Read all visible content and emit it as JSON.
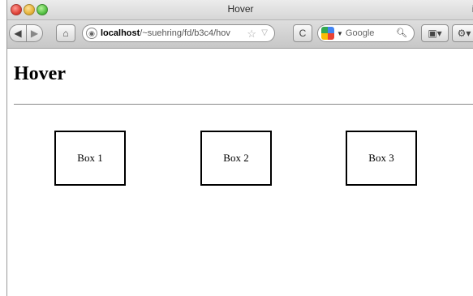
{
  "window": {
    "title": "Hover",
    "title_suffix": "i"
  },
  "toolbar": {
    "back_label": "◀",
    "forward_label": "▶",
    "home_label": "⌂",
    "url_host": "localhost",
    "url_path": "/~suehring/fd/b3c4/hov",
    "reload_label": "C",
    "search_placeholder": "Google",
    "extra1_label": "▣▾",
    "extra2_label": "⚙▾"
  },
  "page": {
    "heading": "Hover",
    "boxes": [
      {
        "label": "Box 1"
      },
      {
        "label": "Box 2"
      },
      {
        "label": "Box 3"
      }
    ]
  }
}
